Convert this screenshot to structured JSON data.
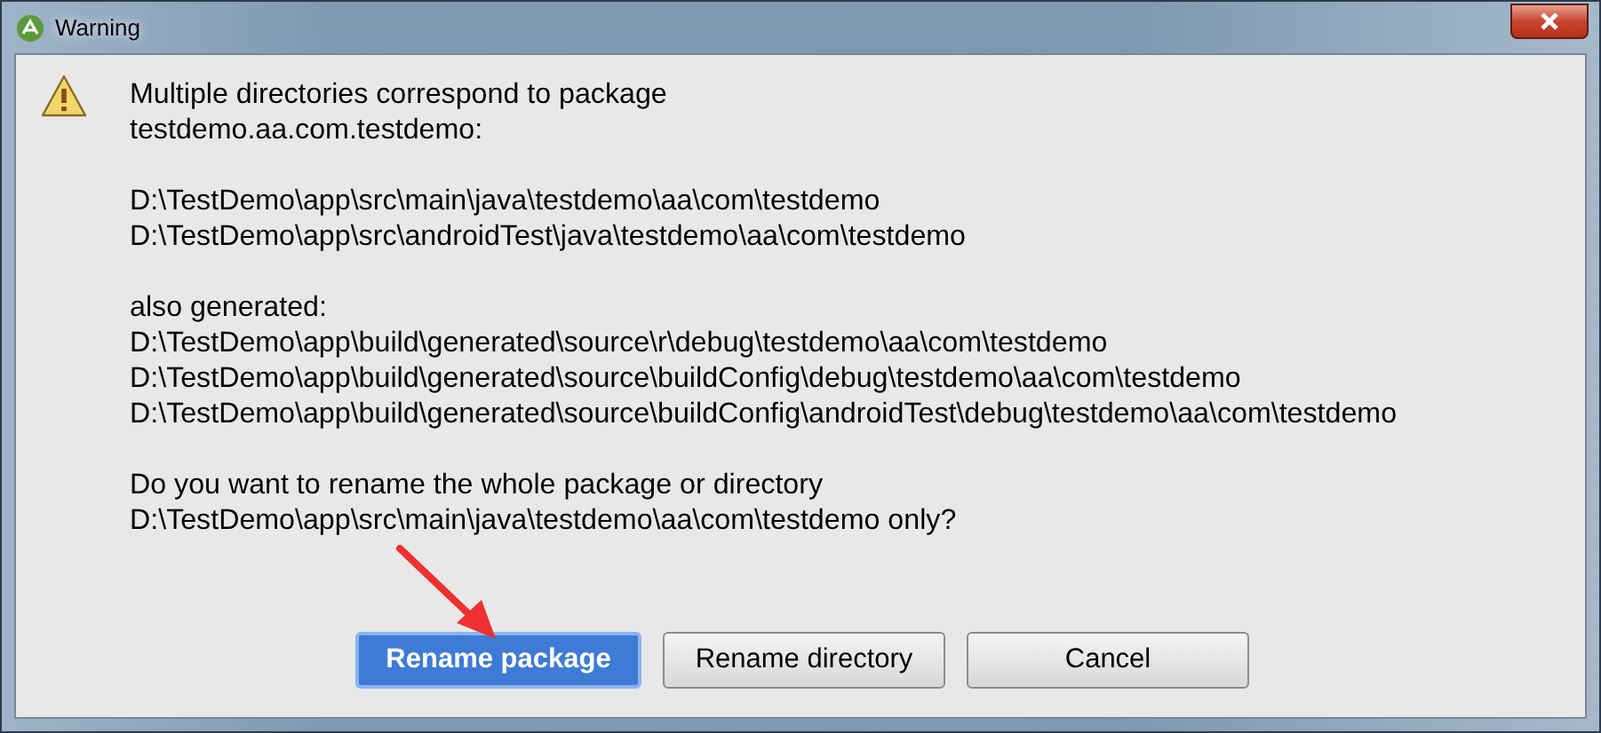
{
  "window": {
    "title": "Warning"
  },
  "message": {
    "paragraphs": [
      [
        "Multiple directories correspond to package",
        "testdemo.aa.com.testdemo:"
      ],
      [
        "D:\\TestDemo\\app\\src\\main\\java\\testdemo\\aa\\com\\testdemo",
        "D:\\TestDemo\\app\\src\\androidTest\\java\\testdemo\\aa\\com\\testdemo"
      ],
      [
        "also generated:",
        "D:\\TestDemo\\app\\build\\generated\\source\\r\\debug\\testdemo\\aa\\com\\testdemo",
        "D:\\TestDemo\\app\\build\\generated\\source\\buildConfig\\debug\\testdemo\\aa\\com\\testdemo",
        "D:\\TestDemo\\app\\build\\generated\\source\\buildConfig\\androidTest\\debug\\testdemo\\aa\\com\\testdemo"
      ],
      [
        "Do you want to rename the whole package or directory",
        "D:\\TestDemo\\app\\src\\main\\java\\testdemo\\aa\\com\\testdemo only?"
      ]
    ]
  },
  "buttons": [
    {
      "label": "Rename package",
      "default": true
    },
    {
      "label": "Rename directory",
      "default": false
    },
    {
      "label": "Cancel",
      "default": false
    }
  ]
}
